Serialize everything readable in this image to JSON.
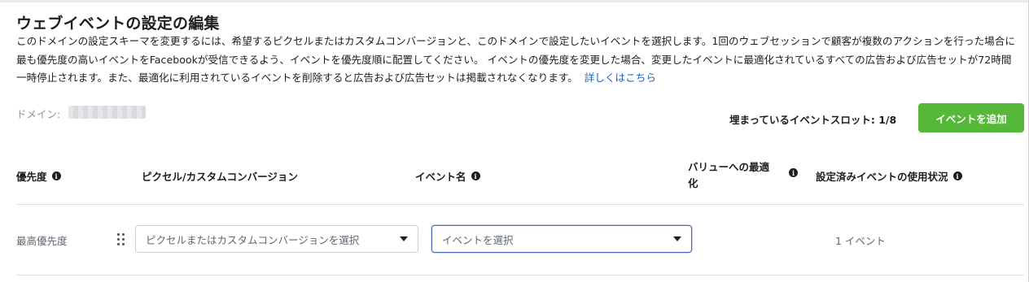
{
  "header": {
    "title": "ウェブイベントの設定の編集",
    "description": "このドメインの設定スキーマを変更するには、希望するピクセルまたはカスタムコンバージョンと、このドメインで設定したいイベントを選択します。1回のウェブセッションで顧客が複数のアクションを行った場合に最も優先度の高いイベントをFacebookが受信できるよう、イベントを優先度順に配置してください。 イベントの優先度を変更した場合、変更したイベントに最適化されているすべての広告および広告セットが72時間一時停止されます。また、最適化に利用されているイベントを削除すると広告および広告セットは掲載されなくなります。",
    "learn_more": "詳しくはこちら"
  },
  "domain": {
    "label": "ドメイン:"
  },
  "slots": {
    "text": "埋まっているイベントスロット: 1/8"
  },
  "actions": {
    "add_event": "イベントを追加"
  },
  "table": {
    "columns": {
      "priority": "優先度",
      "pixel": "ピクセル/カスタムコンバージョン",
      "event_name": "イベント名",
      "value_opt_line1": "バリューへの最適",
      "value_opt_line2": "化",
      "usage": "設定済みイベントの使用状況"
    },
    "rows": [
      {
        "priority": "最高優先度",
        "pixel_placeholder": "ピクセルまたはカスタムコンバージョンを選択",
        "event_placeholder": "イベントを選択",
        "usage": "1 イベント"
      }
    ]
  },
  "colors": {
    "accent_green": "#56b839",
    "link_blue": "#1d5fc3",
    "focus_blue": "#4267b2"
  }
}
